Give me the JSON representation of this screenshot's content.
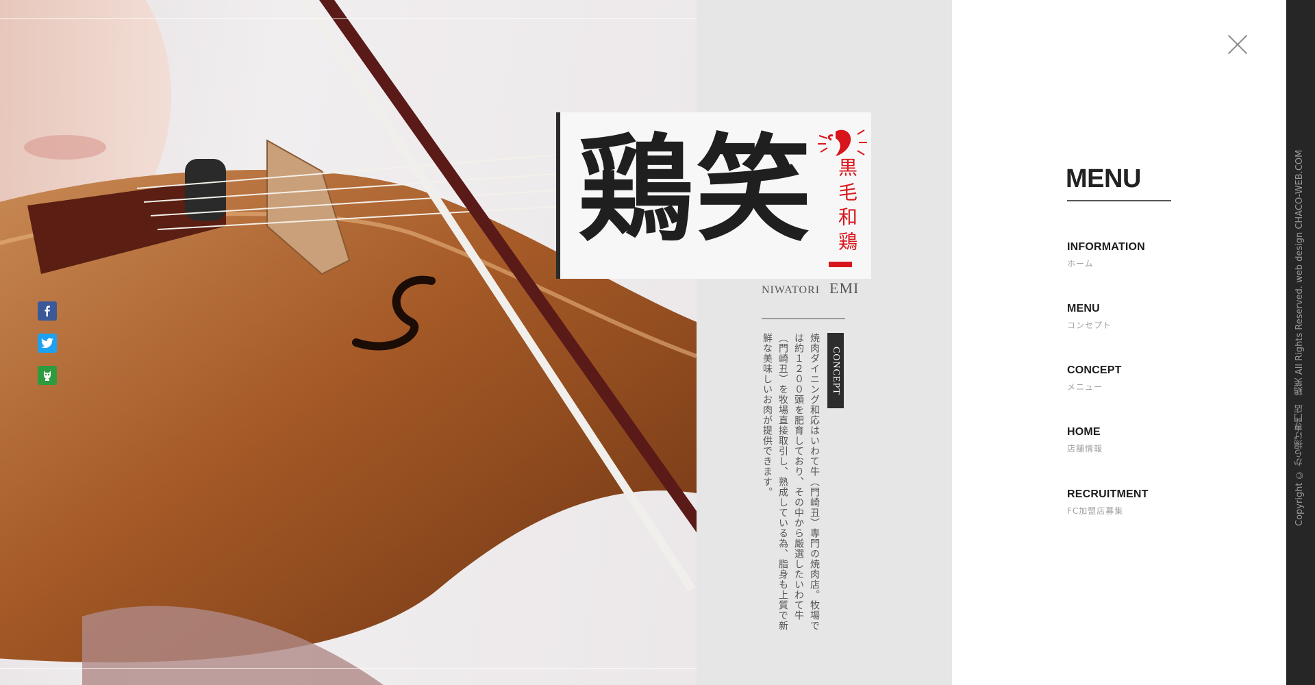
{
  "social": {
    "facebook_icon": "facebook-icon",
    "twitter_icon": "twitter-icon",
    "line_icon": "line-icon",
    "colors": {
      "facebook": "#3b5998",
      "twitter": "#1da1f2",
      "line": "#2d9b3e"
    }
  },
  "brand": {
    "logo_main": "鶏笑",
    "logo_side": "黒毛和鶏",
    "sub_left": "NIWATORI",
    "sub_right": "EMI",
    "accent_color": "#d8151b"
  },
  "concept": {
    "tag": "CONCEPT",
    "text": "焼肉ダイニング和応はいわて牛（門崎丑）専門の焼肉店。牧場では約１２００頭を肥育しており、その中から厳選したいわて牛（門崎丑）を牧場直接取引し、熟成している為、脂身も上質で新鮮な美味しいお肉が提供できます。"
  },
  "menu": {
    "title": "MENU",
    "close_icon": "close-icon",
    "items": [
      {
        "en": "INFORMATION",
        "ja": "ホーム"
      },
      {
        "en": "MENU",
        "ja": "コンセプト"
      },
      {
        "en": "CONCEPT",
        "ja": "メニュー"
      },
      {
        "en": "HOME",
        "ja": "店舗情報"
      },
      {
        "en": "RECRUITMENT",
        "ja": "FC加盟店募集"
      }
    ]
  },
  "footer": {
    "copyright": "Copyright © から揚げ専門店　鶏笑 All Rights Reserved. web design CHACO-WEB.COM"
  }
}
